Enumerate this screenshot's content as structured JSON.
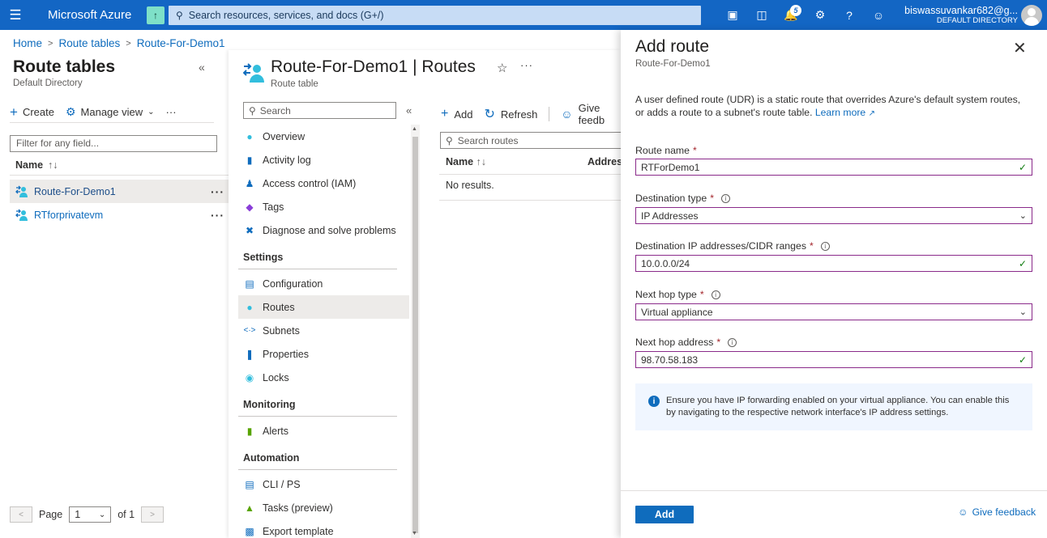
{
  "topbar": {
    "brand": "Microsoft Azure",
    "search_placeholder": "Search resources, services, and docs (G+/)",
    "notifications_count": "5",
    "user_email": "biswassuvankar682@g...",
    "user_directory": "DEFAULT DIRECTORY"
  },
  "breadcrumb": {
    "items": [
      "Home",
      "Route tables",
      "Route-For-Demo1"
    ]
  },
  "left_panel": {
    "title": "Route tables",
    "subtitle": "Default Directory",
    "create_label": "Create",
    "manage_view_label": "Manage view",
    "filter_placeholder": "Filter for any field...",
    "column_name": "Name",
    "rows": [
      {
        "name": "Route-For-Demo1"
      },
      {
        "name": "RTforprivatevm"
      }
    ],
    "pager": {
      "page_label": "Page",
      "page_value": "1",
      "of_label": "of 1"
    }
  },
  "resource_blade": {
    "title": "Route-For-Demo1",
    "title_suffix": "| Routes",
    "subtitle": "Route table",
    "menu_search_placeholder": "Search",
    "menu": {
      "top": [
        "Overview",
        "Activity log",
        "Access control (IAM)",
        "Tags",
        "Diagnose and solve problems"
      ],
      "settings_header": "Settings",
      "settings": [
        "Configuration",
        "Routes",
        "Subnets",
        "Properties",
        "Locks"
      ],
      "monitoring_header": "Monitoring",
      "monitoring": [
        "Alerts"
      ],
      "automation_header": "Automation",
      "automation": [
        "CLI / PS",
        "Tasks (preview)",
        "Export template"
      ]
    },
    "toolbar": {
      "add": "Add",
      "refresh": "Refresh",
      "feedback": "Give feedb"
    },
    "routes_search_placeholder": "Search routes",
    "columns": [
      "Name",
      "Address"
    ],
    "empty_text": "No results."
  },
  "add_route": {
    "title": "Add route",
    "subtitle": "Route-For-Demo1",
    "description": "A user defined route (UDR) is a static route that overrides Azure's default system routes, or adds a route to a subnet's route table.",
    "learn_more": "Learn more",
    "fields": {
      "route_name_label": "Route name",
      "route_name_value": "RTForDemo1",
      "dest_type_label": "Destination type",
      "dest_type_value": "IP Addresses",
      "dest_ip_label": "Destination IP addresses/CIDR ranges",
      "dest_ip_value": "10.0.0.0/24",
      "next_hop_type_label": "Next hop type",
      "next_hop_type_value": "Virtual appliance",
      "next_hop_addr_label": "Next hop address",
      "next_hop_addr_value": "98.70.58.183"
    },
    "info_text": "Ensure you have IP forwarding enabled on your virtual appliance. You can enable this by navigating to the respective network interface's IP address settings.",
    "add_button": "Add",
    "give_feedback": "Give feedback"
  },
  "colors": {
    "azure_blue": "#0f6cbd",
    "topbar": "#1366c4",
    "valid_check": "#107c10",
    "required": "#a4262c"
  }
}
